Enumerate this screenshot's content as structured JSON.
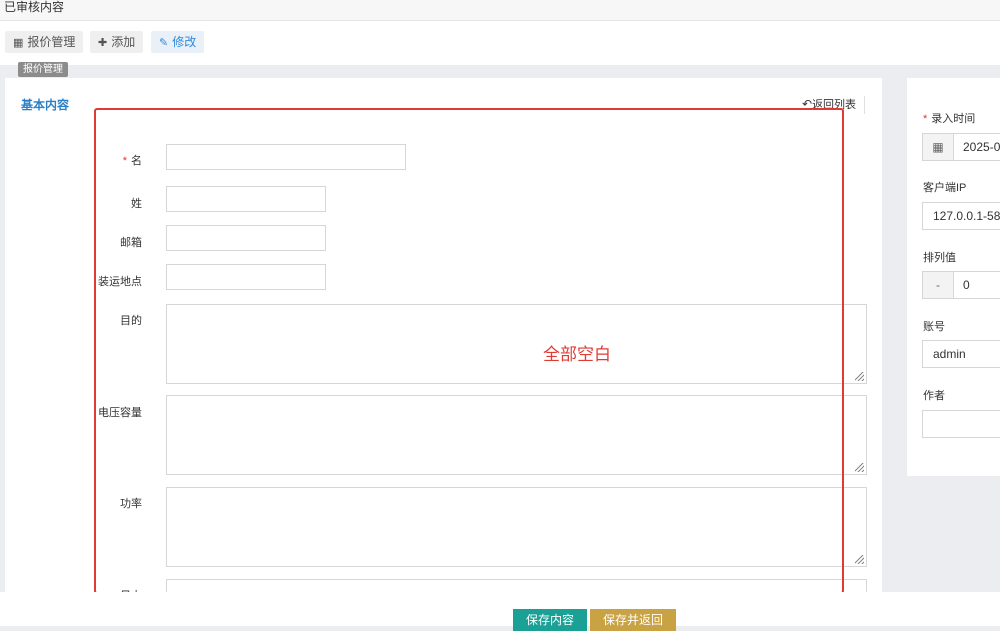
{
  "topbar": {
    "title": "已审核内容"
  },
  "toolbar": {
    "manage_label": "报价管理",
    "add_label": "添加",
    "edit_label": "修改",
    "tooltip": "报价管理",
    "icons": {
      "manage": "table-icon",
      "add": "plus-icon",
      "edit": "edit-icon"
    }
  },
  "form": {
    "section_title": "基本内容",
    "back_label": "返回列表",
    "fields": {
      "first_name": "名",
      "last_name": "姓",
      "email": "邮箱",
      "location": "装运地点",
      "purpose": "目的",
      "voltage": "电压容量",
      "power": "功率",
      "partial": "日上"
    },
    "required_marker": "*",
    "annotation": "全部空白",
    "annotation_color": "#e03a33"
  },
  "sidebar": {
    "entry_time_label": "录入时间",
    "entry_time_value": "2025-0",
    "client_ip_label": "客户端IP",
    "client_ip_value": "127.0.0.1-58",
    "sort_label": "排列值",
    "sort_minus": "-",
    "sort_value": "0",
    "account_label": "账号",
    "account_value": "admin",
    "author_label": "作者",
    "author_value": ""
  },
  "footer": {
    "save_label": "保存内容",
    "save_back_label": "保存并返回",
    "save_color": "#1aa094",
    "save_back_color": "#c9a244"
  }
}
